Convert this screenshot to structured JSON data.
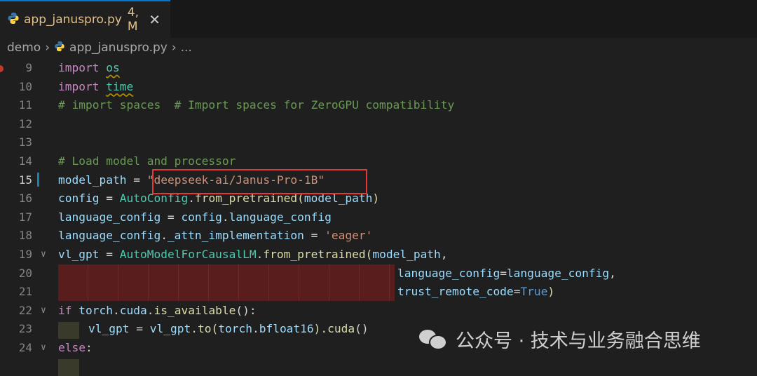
{
  "tab": {
    "filename": "app_januspro.py",
    "badge": "4, M",
    "close": "✕"
  },
  "breadcrumb": {
    "folder": "demo",
    "file": "app_januspro.py",
    "more": "..."
  },
  "lines": [
    {
      "n": "9"
    },
    {
      "n": "10"
    },
    {
      "n": "11"
    },
    {
      "n": "12"
    },
    {
      "n": "13"
    },
    {
      "n": "14"
    },
    {
      "n": "15"
    },
    {
      "n": "16"
    },
    {
      "n": "17"
    },
    {
      "n": "18"
    },
    {
      "n": "19"
    },
    {
      "n": "20"
    },
    {
      "n": "21"
    },
    {
      "n": "22"
    },
    {
      "n": "23"
    },
    {
      "n": "24"
    }
  ],
  "code": {
    "l9": {
      "kw": "import",
      "mod": "os"
    },
    "l10": {
      "kw": "import",
      "mod": "time"
    },
    "l11": {
      "comment": "# import spaces  # Import spaces for ZeroGPU compatibility"
    },
    "l14": {
      "comment": "# Load model and processor"
    },
    "l15": {
      "var": "model_path",
      "op": " = ",
      "str": "\"deepseek-ai/Janus-Pro-1B\""
    },
    "l16": {
      "var": "config",
      "op": " = ",
      "cls": "AutoConfig",
      "dot": ".",
      "fn": "from_pretrained",
      "p1": "(",
      "arg": "model_path",
      "p2": ")"
    },
    "l17": {
      "var": "language_config",
      "op": " = ",
      "obj": "config",
      "dot": ".",
      "attr": "language_config"
    },
    "l18": {
      "var": "language_config",
      "dot": ".",
      "attr": "_attn_implementation",
      "op": " = ",
      "str": "'eager'"
    },
    "l19": {
      "var": "vl_gpt",
      "op": " = ",
      "cls": "AutoModelForCausalLM",
      "dot": ".",
      "fn": "from_pretrained",
      "p1": "(",
      "arg": "model_path",
      "comma": ","
    },
    "l20": {
      "kwarg": "language_config",
      "eq": "=",
      "val": "language_config",
      "comma": ","
    },
    "l21": {
      "kwarg": "trust_remote_code",
      "eq": "=",
      "val": "True",
      "p2": ")"
    },
    "l22": {
      "kw": "if",
      "obj": "torch",
      "dot1": ".",
      "attr": "cuda",
      "dot2": ".",
      "fn": "is_available",
      "rest": "():"
    },
    "l23": {
      "var": "vl_gpt",
      "op": " = ",
      "obj": "vl_gpt",
      "dot1": ".",
      "fn": "to",
      "p1": "(",
      "arg": "torch",
      "dot2": ".",
      "attr": "bfloat16",
      "p2": ").",
      "fn2": "cuda",
      "rest": "()"
    },
    "l24": {
      "kw": "else",
      "rest": ":"
    }
  },
  "watermark": {
    "text": "公众号 · 技术与业务融合思维"
  }
}
